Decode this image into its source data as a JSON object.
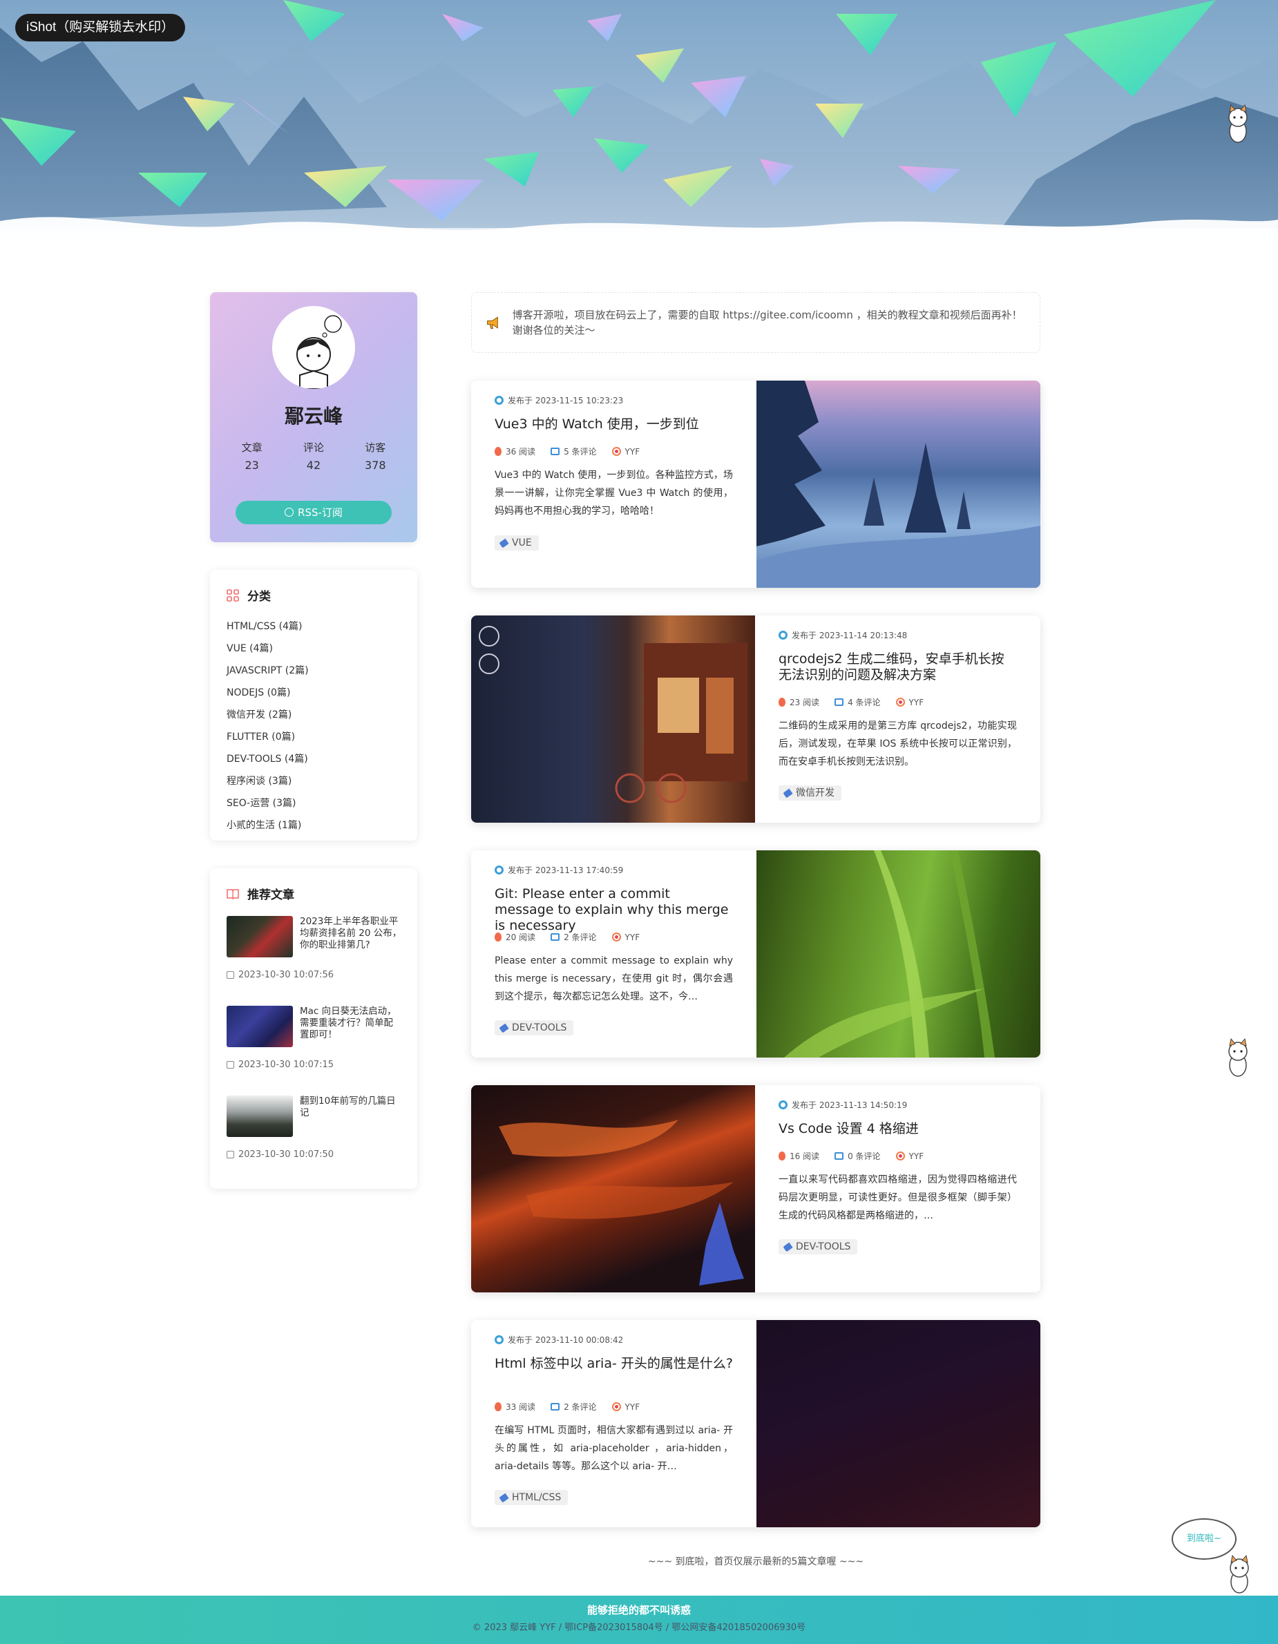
{
  "badge": "iShot（购买解锁去水印）",
  "profile": {
    "name": "鄢云峰",
    "stats": [
      {
        "label": "文章",
        "value": "23"
      },
      {
        "label": "评论",
        "value": "42"
      },
      {
        "label": "访客",
        "value": "378"
      }
    ],
    "rss_label": "RSS-订阅"
  },
  "categories": {
    "title": "分类",
    "items": [
      "HTML/CSS (4篇)",
      "VUE (4篇)",
      "JAVASCRIPT (2篇)",
      "NODEJS (0篇)",
      "微信开发 (2篇)",
      "FLUTTER (0篇)",
      "DEV-TOOLS (4篇)",
      "程序闲谈 (3篇)",
      "SEO-运营 (3篇)",
      "小贰的生活 (1篇)"
    ]
  },
  "recommended": {
    "title": "推荐文章",
    "items": [
      {
        "title": "2023年上半年各职业平均薪资排名前 20 公布，你的职业排第几?",
        "date": "2023-10-30 10:07:56"
      },
      {
        "title": "Mac 向日葵无法启动，需要重装才行？简单配置即可！",
        "date": "2023-10-30 10:07:15"
      },
      {
        "title": "翻到10年前写的几篇日记",
        "date": "2023-10-30 10:07:50"
      }
    ]
  },
  "notice": "博客开源啦，项目放在码云上了，需要的自取 https://gitee.com/icoomn ，相关的教程文章和视频后面再补！谢谢各位的关注～",
  "posts": [
    {
      "date": "发布于 2023-11-15 10:23:23",
      "title": "Vue3 中的 Watch 使用，一步到位",
      "reads": "36 阅读",
      "comments": "5 条评论",
      "author": "YYF",
      "excerpt": "Vue3 中的 Watch 使用，一步到位。各种监控方式，场景一一讲解，让你完全掌握 Vue3 中 Watch 的使用，妈妈再也不用担心我的学习，哈哈哈！",
      "tag": "VUE"
    },
    {
      "date": "发布于 2023-11-14 20:13:48",
      "title": "qrcodejs2 生成二维码，安卓手机长按无法识别的问题及解决方案",
      "reads": "23 阅读",
      "comments": "4 条评论",
      "author": "YYF",
      "excerpt": "二维码的生成采用的是第三方库 qrcodejs2，功能实现后，测试发现，在苹果 IOS 系统中长按可以正常识别，而在安卓手机长按则无法识别。",
      "tag": "微信开发"
    },
    {
      "date": "发布于 2023-11-13 17:40:59",
      "title": "Git: Please enter a commit message to explain why this merge is necessary",
      "reads": "20 阅读",
      "comments": "2 条评论",
      "author": "YYF",
      "excerpt": "Please enter a commit message to explain why this merge is necessary，在使用 git 时，偶尔会遇到这个提示，每次都忘记怎么处理。这不，今…",
      "tag": "DEV-TOOLS"
    },
    {
      "date": "发布于 2023-11-13 14:50:19",
      "title": "Vs Code 设置 4 格缩进",
      "reads": "16 阅读",
      "comments": "0 条评论",
      "author": "YYF",
      "excerpt": "一直以来写代码都喜欢四格缩进，因为觉得四格缩进代码层次更明显，可读性更好。但是很多框架（脚手架）生成的代码风格都是两格缩进的，…",
      "tag": "DEV-TOOLS"
    },
    {
      "date": "发布于 2023-11-10 00:08:42",
      "title": "Html 标签中以 aria- 开头的属性是什么?",
      "reads": "33 阅读",
      "comments": "2 条评论",
      "author": "YYF",
      "excerpt": "在编写 HTML 页面时，相信大家都有遇到过以 aria- 开头的属性，如 aria-placeholder ，aria-hidden，aria-details 等等。那么这个以 aria- 开…",
      "tag": "HTML/CSS"
    }
  ],
  "end_note": "~~~ 到底啦，首页仅展示最新的5篇文章喔 ~~~",
  "bubble": "到底啦~",
  "footer": {
    "slogan": "能够拒绝的都不叫诱惑",
    "copyright": "© 2023 鄢云峰 YYF / 鄂ICP备2023015804号 / 鄂公网安备42018502006930号"
  },
  "colors": {
    "accent": "#3ec2b5",
    "footer": "#3ec4b2"
  }
}
